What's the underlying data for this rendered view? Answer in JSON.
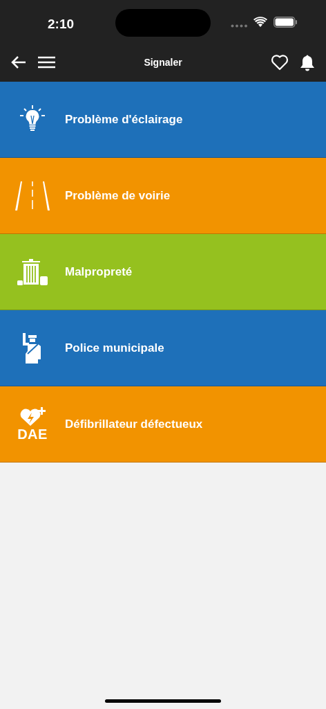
{
  "status_bar": {
    "time": "2:10"
  },
  "nav_bar": {
    "title": "Signaler"
  },
  "categories": [
    {
      "kind": "lighting",
      "label": "Problème d'éclairage",
      "color": "#1e70b9"
    },
    {
      "kind": "road",
      "label": "Problème de voirie",
      "color": "#f29300"
    },
    {
      "kind": "trash",
      "label": "Malpropreté",
      "color": "#95c11f"
    },
    {
      "kind": "police",
      "label": "Police municipale",
      "color": "#1e70b9"
    },
    {
      "kind": "defibrillator",
      "label": "Défibrillateur défectueux",
      "color": "#f29300",
      "icon_text": "DAE"
    }
  ]
}
